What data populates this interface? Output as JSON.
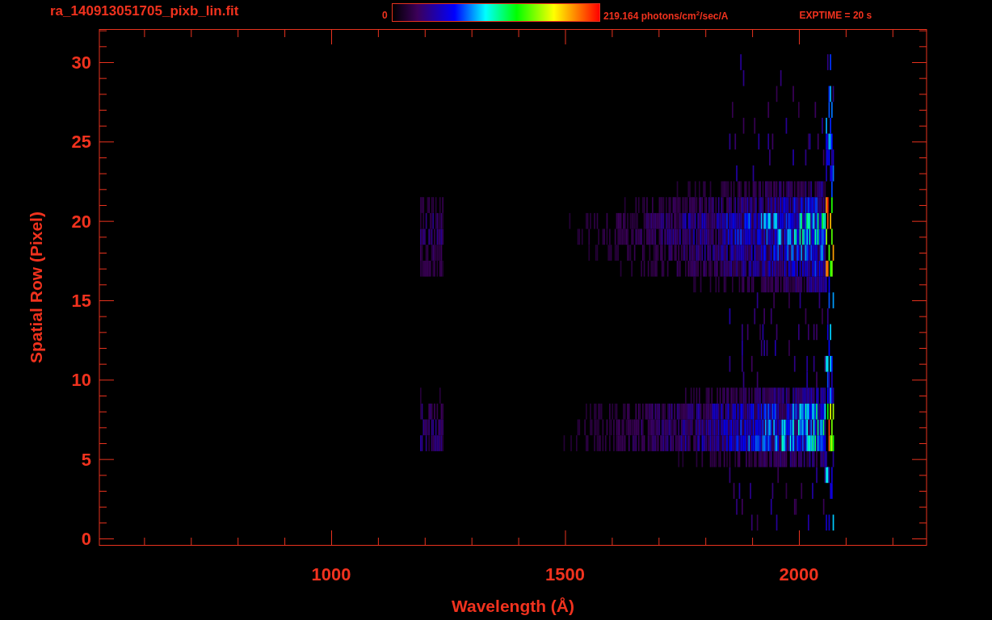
{
  "title": "ra_140913051705_pixb_lin.fit",
  "colorbar": {
    "min_label": "0",
    "max_label": "219.164 photons/cm$^{2}$/sec/A"
  },
  "exposure": "EXPTIME = 20 s",
  "plot": {
    "xlabel": "Wavelength (Å)",
    "ylabel": "Spatial Row (Pixel)",
    "xtick_labels": [
      "1000",
      "1500",
      "2000"
    ],
    "ytick_labels": [
      "30",
      "25",
      "20",
      "15",
      "10",
      "5",
      "0"
    ]
  }
}
